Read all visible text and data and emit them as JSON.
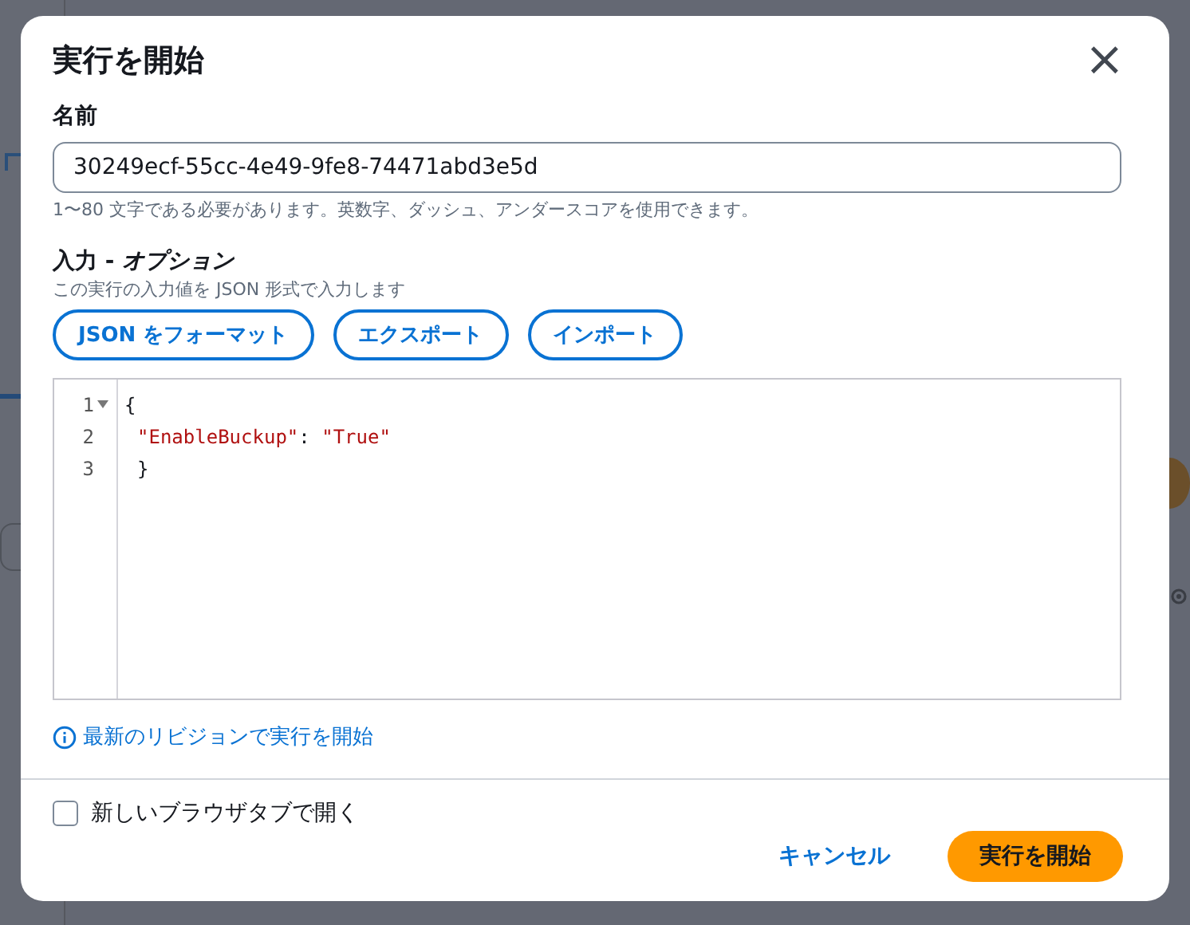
{
  "dialog": {
    "title": "実行を開始",
    "close": "×",
    "name_field": {
      "label": "名前",
      "value": "30249ecf-55cc-4e49-9fe8-74471abd3e5d",
      "hint": "1〜80 文字である必要があります。英数字、ダッシュ、アンダースコアを使用できます。"
    },
    "input_section": {
      "label": "入力 - *オプション*",
      "description": "この実行の入力値を JSON 形式で入力します",
      "buttons": [
        "JSON をフォーマット",
        "エクスポート",
        "インポート"
      ],
      "editor": {
        "lines": [
          {
            "number": "1",
            "foldable": true,
            "indented": false,
            "tokens": [
              {
                "kind": "punct",
                "text": "{"
              }
            ]
          },
          {
            "number": "2",
            "foldable": false,
            "indented": true,
            "tokens": [
              {
                "kind": "string",
                "text": "\"EnableBuckup\""
              },
              {
                "kind": "punct",
                "text": ": "
              },
              {
                "kind": "string",
                "text": "\"True\""
              }
            ]
          },
          {
            "number": "3",
            "foldable": false,
            "indented": true,
            "tokens": [
              {
                "kind": "punct",
                "text": "}"
              }
            ]
          }
        ]
      }
    },
    "info_link": "最新のリビジョンで実行を開始",
    "new_tab_option": {
      "label": "新しいブラウザタブで開く",
      "checked": false
    },
    "footer_buttons": [
      {
        "kind": "link",
        "label": "キャンセル"
      },
      {
        "kind": "primary",
        "label": "実行を開始"
      }
    ]
  }
}
